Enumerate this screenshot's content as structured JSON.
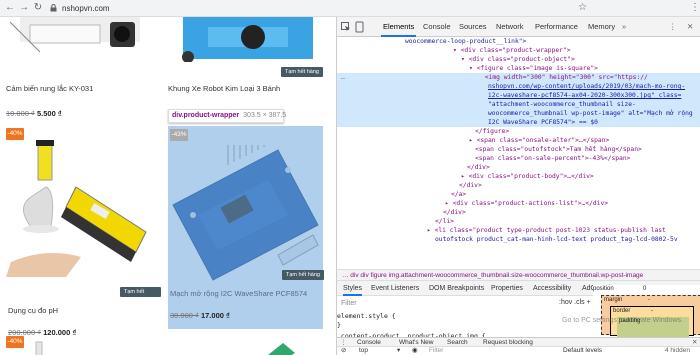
{
  "browser": {
    "url": "nshopvn.com"
  },
  "products": [
    {
      "name": "Cảm biến rung lắc KY-031",
      "old_price": "10.000 ₫",
      "price": "5.500 ₫"
    },
    {
      "name": "Khung Xe Robot Kim Loại 3 Bánh",
      "badge": "Tạm hết hàng"
    },
    {
      "name": "Dụng cụ đo pH",
      "old_price": "200.000 ₫",
      "price": "120.000 ₫",
      "sale": "-40%",
      "badge": "Tạm hết hàng"
    },
    {
      "name": "Mạch mở rộng I2C WaveShare PCF8574",
      "old_price": "30.000 ₫",
      "price": "17.000 ₫",
      "sale": "-43%",
      "badge": "Tạm hết hàng"
    },
    {
      "sale": "-40%"
    }
  ],
  "tooltip": {
    "selector": "div.product-wrapper",
    "size": "303.5 × 387.5"
  },
  "devtools": {
    "tabs": [
      "Elements",
      "Console",
      "Sources",
      "Network",
      "Performance",
      "Memory"
    ],
    "dom_lines": [
      "woocommerce-loop-product__link\">",
      "<div class=\"product-wrapper\">",
      "<div class=\"product-object\">",
      "<figure class=\"image is-square\">",
      "<img width=\"300\" height=\"300\" src=\"https://",
      "nshopvn.com/wp-content/uploads/2019/03/mach-mo-rong-",
      "i2c-waveshare-pcf8574-ax04-2020-300x300.jpg\" class=",
      "\"attachment-woocommerce_thumbnail size-",
      "woocommerce_thumbnail wp-post-image\" alt=\"Mạch mở rộng",
      "I2C WaveShare PCF8574\"> == $0",
      "</figure>",
      "<span class=\"onsale-alter\">…</span>",
      "<span class=\"outofstock\">Tạm hết hàng</span>",
      "<span class=\"on-sale-percent\">-43%</span>",
      "</div>",
      "<div class=\"product-body\">…</div>",
      "</div>",
      "</a>",
      "<div class=\"product-actions-list\">…</div>",
      "</div>",
      "</li>",
      "<li class=\"product type-product post-1023 status-publish last",
      "outofstock product_cat-man-hinh-lcd-text product_tag-lcd-0802-5v"
    ],
    "breadcrumb": "…  div   div   figure   img.attachment-woocommerce_thumbnail.size-woocommerce_thumbnail.wp-post-image",
    "style_tabs": [
      "Styles",
      "Event Listeners",
      "DOM Breakpoints",
      "Properties",
      "Accessibility",
      "AdGuard"
    ],
    "filter_placeholder": "Filter",
    "hov": ":hov  .cls  +",
    "styles_lines": [
      "element.style {",
      "}",
      ".content-product .product-object img {"
    ],
    "box": {
      "position": "position",
      "position_val": "0",
      "margin": "margin",
      "margin_val": "-",
      "border": "border",
      "border_val": "-",
      "padding": "padding"
    },
    "drawer_tabs": [
      "Console",
      "What's New",
      "Search",
      "Request blocking"
    ],
    "console_context": "top",
    "console_filter": "Filter",
    "levels": "Default levels",
    "hidden": "4 hidden",
    "watermark": "Go to PC settings to activate Windows."
  }
}
